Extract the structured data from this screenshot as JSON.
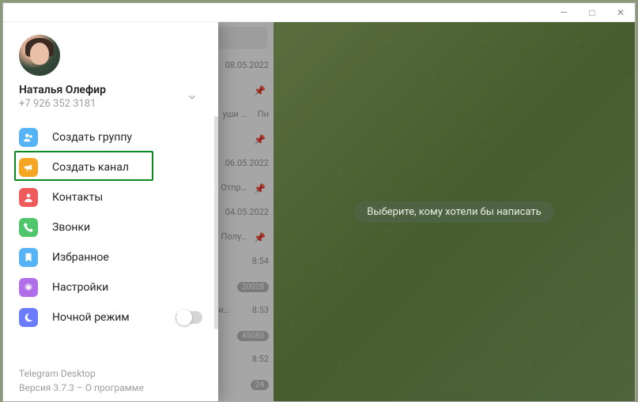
{
  "window": {
    "min_title": "—",
    "max_title": "□",
    "close_title": "✕"
  },
  "profile": {
    "name": "Наталья Олефир",
    "phone": "+7 926 352 3181"
  },
  "menu": {
    "new_group": "Создать группу",
    "new_channel": "Создать канал",
    "contacts": "Контакты",
    "calls": "Звонки",
    "saved": "Избранное",
    "settings": "Настройки",
    "night": "Ночной режим"
  },
  "footer": {
    "app": "Telegram Desktop",
    "version": "Версия 3.7.3 – О программе"
  },
  "main": {
    "placeholder": "Выберите, кому хотели бы написать"
  },
  "chatlist": [
    {
      "date": "08.05.2022",
      "pin": true
    },
    {
      "snippet": "уши …",
      "date": "Пн",
      "pin": true
    },
    {
      "date": "06.05.2022",
      "snippet": "Отпр…",
      "pin": true
    },
    {
      "date": "04.05.2022",
      "snippet": "Полу…",
      "pin": true
    },
    {
      "date": "8:54",
      "badge": "20028"
    },
    {
      "snippet": "али…",
      "date": "8:53",
      "badge": "45080"
    },
    {
      "date": "8:52",
      "badge": "24",
      "fire": true
    }
  ]
}
